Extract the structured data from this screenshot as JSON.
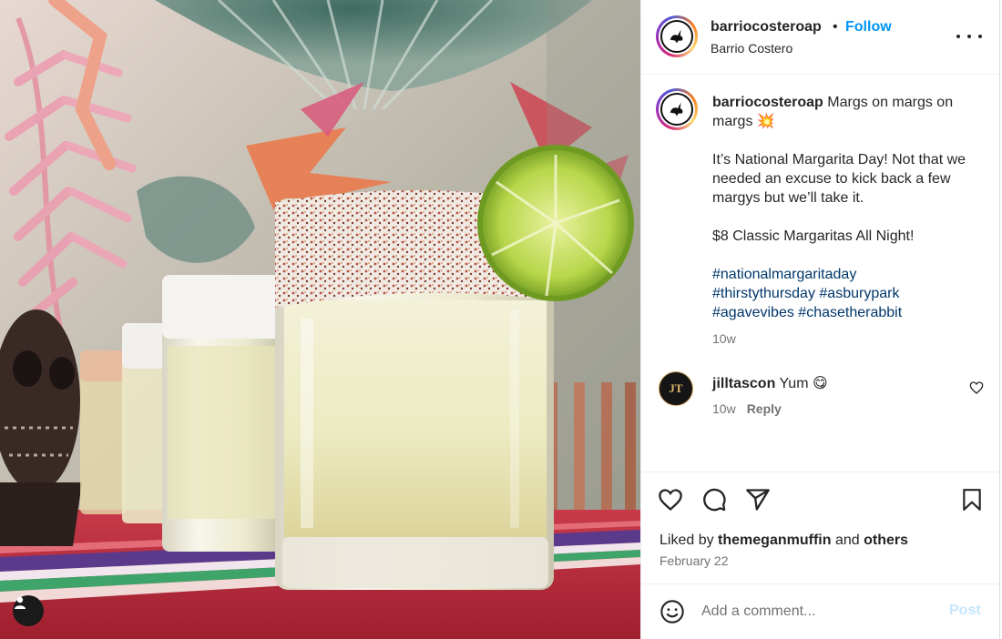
{
  "post": {
    "username": "barriocosteroap",
    "dot": "•",
    "follow_label": "Follow",
    "location": "Barrio Costero",
    "more_icon": "more-horizontal-icon",
    "caption": {
      "username": "barriocosteroap",
      "text_line1": "Margs on margs on margs 💥",
      "text_line2": "It’s National Margarita Day! Not that we needed an excuse to kick back a few margys but we’ll take it.",
      "text_line3": "$8 Classic Margaritas All Night!",
      "hashtags": [
        "#nationalmargaritaday",
        "#thirstythursday",
        "#asburypark",
        "#agavevibes",
        "#chasetherabbit"
      ],
      "time": "10w"
    },
    "comment": {
      "avatar_initials": "JT",
      "username": "jilltascon",
      "text": "Yum 😋",
      "time": "10w",
      "reply_label": "Reply"
    },
    "likes": {
      "prefix": "Liked by",
      "user": "themeganmuffin",
      "conjunction": "and",
      "others": "others"
    },
    "date": "February 22",
    "add_comment": {
      "placeholder": "Add a comment...",
      "post_label": "Post"
    },
    "icons": [
      "heart-icon",
      "comment-icon",
      "share-icon",
      "bookmark-icon",
      "emoji-icon",
      "user-tag-icon"
    ],
    "colors": {
      "follow": "#0095f6",
      "hashtag": "#00376b",
      "secondary_text": "#737373",
      "post_disabled": "#c4e6fd"
    }
  }
}
